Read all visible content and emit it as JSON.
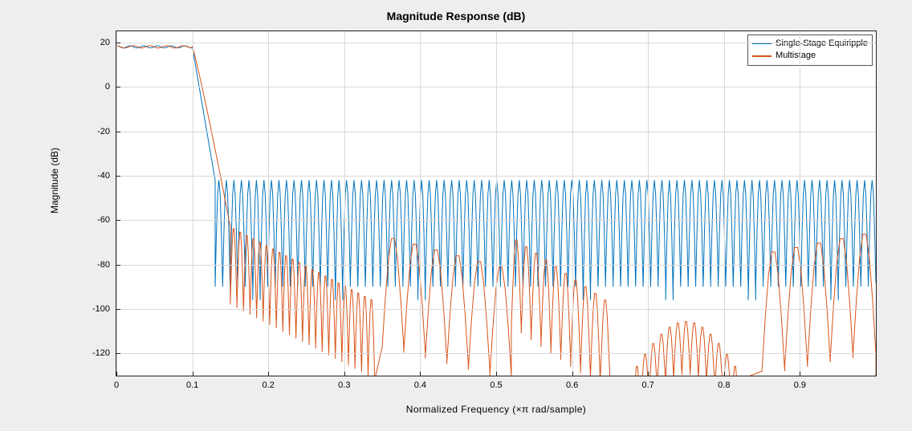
{
  "title": "Magnitude Response (dB)",
  "xlabel": "Normalized  Frequency  (×π rad/sample)",
  "ylabel": "Magnitude (dB)",
  "legend": {
    "items": [
      {
        "name": "Single-Stage Equiripple",
        "color": "#0072BD"
      },
      {
        "name": "Multistage",
        "color": "#D95319"
      }
    ]
  },
  "chart_data": {
    "type": "line",
    "xlim": [
      0,
      1.0
    ],
    "ylim": [
      -130,
      25
    ],
    "xticks": [
      0,
      0.1,
      0.2,
      0.3,
      0.4,
      0.5,
      0.6,
      0.7,
      0.8,
      0.9
    ],
    "yticks": [
      20,
      0,
      -20,
      -40,
      -60,
      -80,
      -100,
      -120
    ],
    "colors": {
      "equiripple": "#0072BD",
      "multistage": "#D95319"
    },
    "series": [
      {
        "name": "Single-Stage Equiripple",
        "color": "#0072BD",
        "passband_ripple_db": 0.5,
        "passband_value_db": 18,
        "passband_edge": 0.1,
        "stopband_edge": 0.13,
        "stopband_top_db": -42,
        "stopband_null_db": -90,
        "stopband_lobe_count": 88
      },
      {
        "name": "Multistage",
        "color": "#D95319",
        "passband_ripple_db": 0.5,
        "passband_value_db": 18,
        "passband_edge": 0.1,
        "stopband_edge": 0.15,
        "stopband_segments": [
          {
            "x0": 0.15,
            "x1": 0.34,
            "top0": -63,
            "top1": -95,
            "lobes": 22,
            "null_offset": 35
          },
          {
            "x0": 0.35,
            "x1": 0.52,
            "top0": -67,
            "top1": -80,
            "lobes": 6,
            "null_offset": 50
          },
          {
            "x0": 0.52,
            "x1": 0.65,
            "top0": -68,
            "top1": -95,
            "lobes": 10,
            "null_offset": 40
          },
          {
            "x0": 0.68,
            "x1": 0.82,
            "top0": -128,
            "top1": -105,
            "lobes": 13,
            "null_offset": 24,
            "parabolic": true,
            "peak": -105
          },
          {
            "x0": 0.85,
            "x1": 1.0,
            "top0": -73,
            "top1": -65,
            "lobes": 5,
            "null_offset": 55
          }
        ]
      }
    ]
  }
}
